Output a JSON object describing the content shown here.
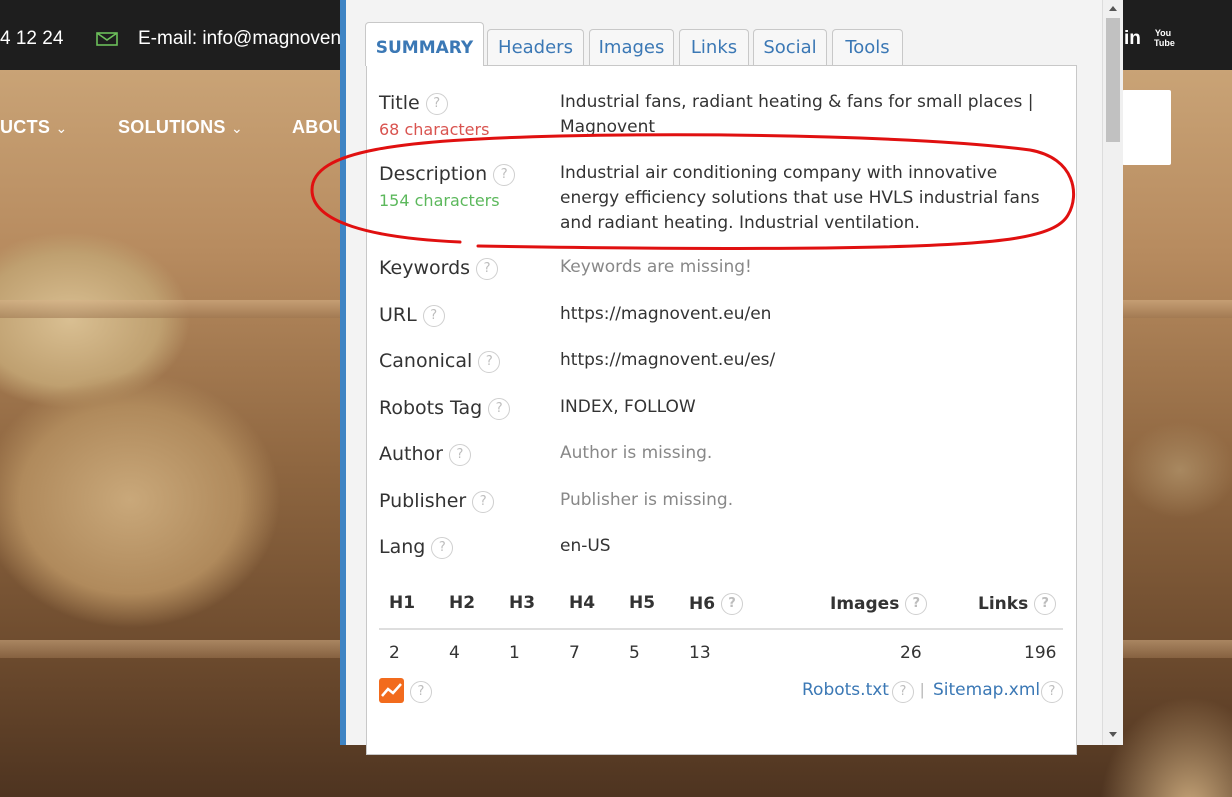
{
  "site": {
    "phone": "4 12 24",
    "email": "E-mail: info@magnovent",
    "linkedin": "in",
    "youtube": "You Tube",
    "nav": [
      "UCTS",
      "SOLUTIONS",
      "ABOU"
    ]
  },
  "popup": {
    "tabs": [
      "SUMMARY",
      "Headers",
      "Images",
      "Links",
      "Social",
      "Tools"
    ],
    "active_tab": "SUMMARY",
    "help_glyph": "?",
    "rows": {
      "title": {
        "label": "Title",
        "sub": "68 characters",
        "value": "Industrial fans, radiant heating & fans for small places | Magnovent"
      },
      "description": {
        "label": "Description",
        "sub": "154 characters",
        "value": "Industrial air conditioning company with innovative energy efficiency solutions that use HVLS industrial fans and radiant heating. Industrial ventilation."
      },
      "keywords": {
        "label": "Keywords",
        "value": "Keywords are missing!"
      },
      "url": {
        "label": "URL",
        "value": "https://magnovent.eu/en"
      },
      "canonical": {
        "label": "Canonical",
        "value": "https://magnovent.eu/es/"
      },
      "robots": {
        "label": "Robots Tag",
        "value": "INDEX, FOLLOW"
      },
      "author": {
        "label": "Author",
        "value": "Author is missing."
      },
      "publisher": {
        "label": "Publisher",
        "value": "Publisher is missing."
      },
      "lang": {
        "label": "Lang",
        "value": "en-US"
      }
    },
    "headings_table": {
      "h1": {
        "label": "H1",
        "value": "2"
      },
      "h2": {
        "label": "H2",
        "value": "4"
      },
      "h3": {
        "label": "H3",
        "value": "1"
      },
      "h4": {
        "label": "H4",
        "value": "7"
      },
      "h5": {
        "label": "H5",
        "value": "5"
      },
      "h6": {
        "label": "H6",
        "value": "13"
      },
      "images": {
        "label": "Images",
        "value": "26"
      },
      "links": {
        "label": "Links",
        "value": "196"
      }
    },
    "footer_links": {
      "robots": "Robots.txt",
      "sitemap": "Sitemap.xml",
      "separator": "|"
    }
  },
  "colors": {
    "accent": "#3b78b5",
    "warning_red": "#d9534f",
    "ok_green": "#5cb85c",
    "annotation_red": "#e01010"
  }
}
